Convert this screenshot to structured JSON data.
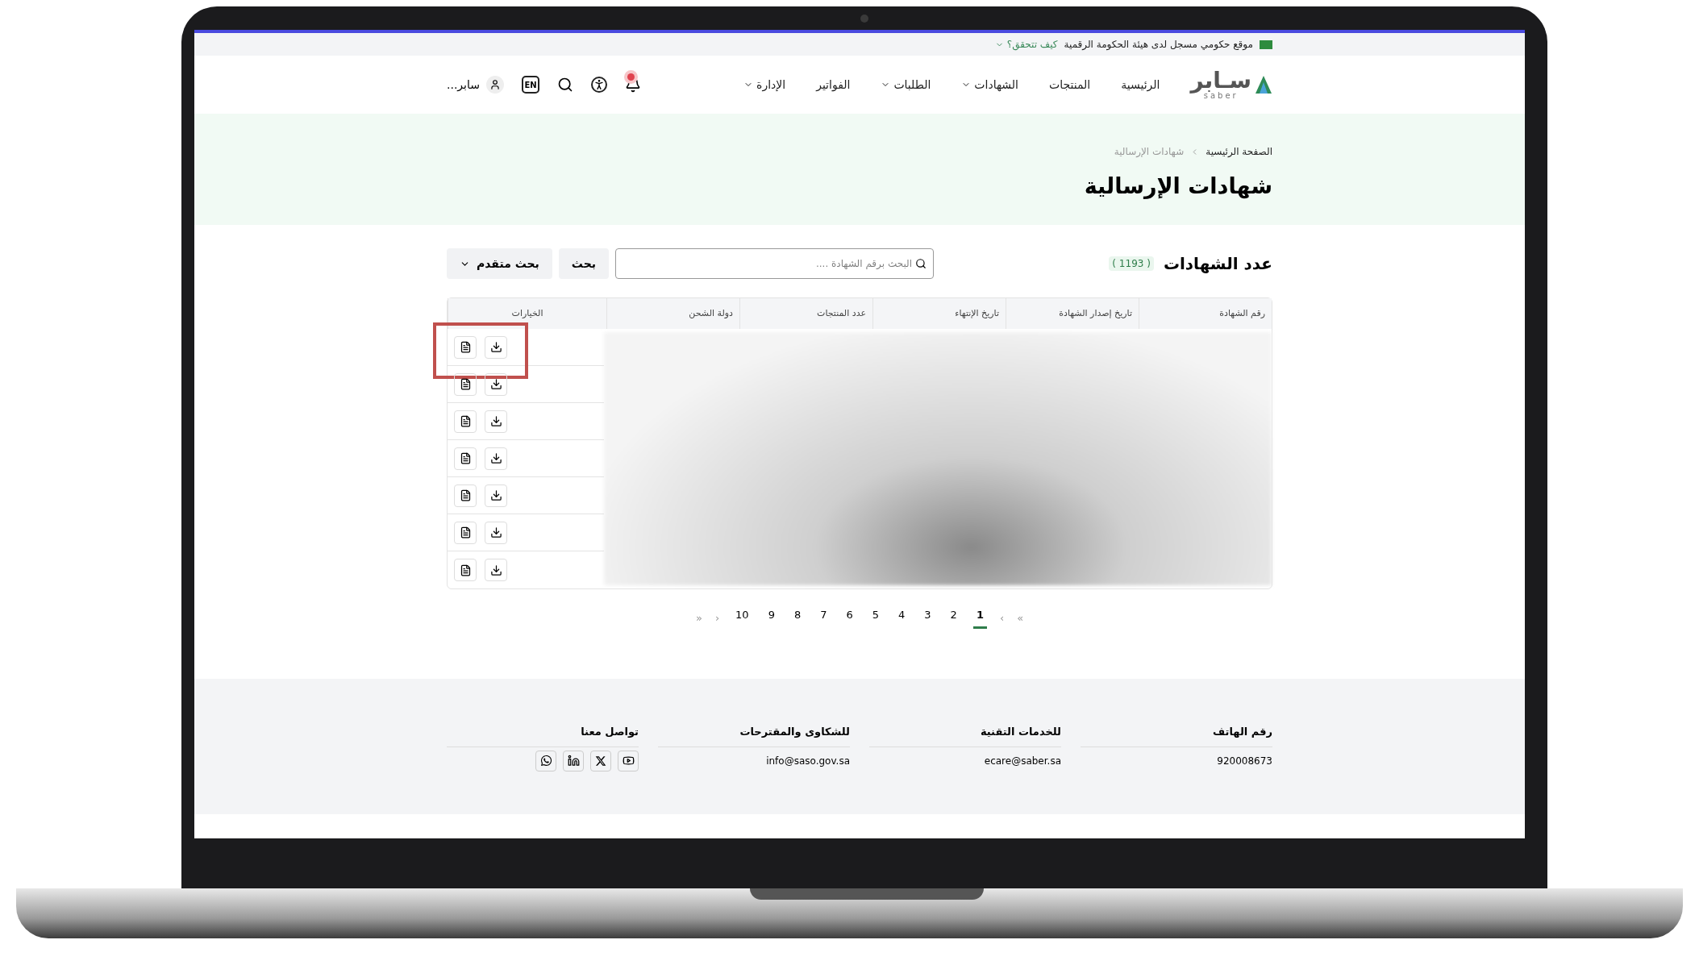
{
  "gov_strip": {
    "text": "موقع حكومي مسجل لدى هيئة الحكومة الرقمية",
    "link": "كيف تتحقق؟"
  },
  "logo": {
    "text": "سـابر",
    "subtitle": "saber"
  },
  "nav": [
    {
      "label": "الرئيسية",
      "dropdown": false
    },
    {
      "label": "المنتجات",
      "dropdown": false
    },
    {
      "label": "الشهادات",
      "dropdown": true
    },
    {
      "label": "الطلبات",
      "dropdown": true
    },
    {
      "label": "الفواتير",
      "dropdown": false
    },
    {
      "label": "الإدارة",
      "dropdown": true
    }
  ],
  "header_tools": {
    "notifications": true,
    "language": "EN",
    "user": "سابر..."
  },
  "breadcrumb": [
    {
      "label": "الصفحة الرئيسية",
      "selected": false
    },
    {
      "label": "شهادات الإرسالية",
      "selected": true
    }
  ],
  "page_title": "شهادات الإرسالية",
  "count": {
    "label": "عدد الشهادات",
    "value": "( 1193 )"
  },
  "search": {
    "placeholder": "البحث برقم الشهادة ....",
    "button": "بحث",
    "advanced": "بحث متقدم"
  },
  "table": {
    "columns": [
      "رقم الشهادة",
      "تاريخ إصدار الشهادة",
      "تاريخ الإنتهاء",
      "عدد المنتجات",
      "دولة الشحن",
      "الخيارات"
    ],
    "rows": [
      {
        "highlighted": true
      },
      {
        "highlighted": false
      },
      {
        "highlighted": false
      },
      {
        "highlighted": false
      },
      {
        "highlighted": false
      },
      {
        "highlighted": false
      },
      {
        "highlighted": false
      }
    ]
  },
  "pagination": {
    "first": "»",
    "prev": "›",
    "next": "‹",
    "last": "«",
    "pages": [
      {
        "label": "1",
        "selected": true
      },
      {
        "label": "2",
        "selected": false
      },
      {
        "label": "3",
        "selected": false
      },
      {
        "label": "4",
        "selected": false
      },
      {
        "label": "5",
        "selected": false
      },
      {
        "label": "6",
        "selected": false
      },
      {
        "label": "7",
        "selected": false
      },
      {
        "label": "8",
        "selected": false
      },
      {
        "label": "9",
        "selected": false
      },
      {
        "label": "10",
        "selected": false
      }
    ]
  },
  "footer": [
    {
      "title": "رقم الهاتف",
      "kind": "text",
      "value": "920008673"
    },
    {
      "title": "للخدمات التقنية",
      "kind": "text",
      "value": "ecare@saber.sa"
    },
    {
      "title": "للشكاوى والمقترحات",
      "kind": "text",
      "value": "info@saso.gov.sa"
    },
    {
      "title": "تواصل معنا",
      "kind": "social"
    }
  ]
}
